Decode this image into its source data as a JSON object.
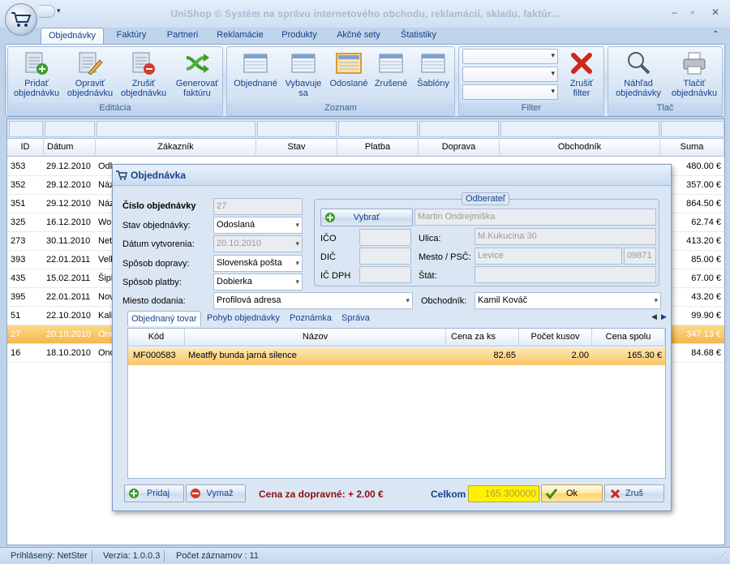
{
  "window": {
    "title": "UniShop © Systém na správu internetového obchodu, reklamácií, skladu,  faktúr..."
  },
  "ribbon_tabs": [
    "Objednávky",
    "Faktúry",
    "Partneri",
    "Reklamácie",
    "Produkty",
    "Akčné sety",
    "Štatistiky"
  ],
  "groups": {
    "editacia": {
      "label": "Editácia",
      "buttons": [
        {
          "line1": "Pridať",
          "line2": "objednávku"
        },
        {
          "line1": "Opraviť",
          "line2": "objednávku"
        },
        {
          "line1": "Zrušiť",
          "line2": "objednávku"
        },
        {
          "line1": "Generovať",
          "line2": "faktúru"
        }
      ]
    },
    "zoznam": {
      "label": "Zoznam",
      "buttons": [
        {
          "line1": "Objednané",
          "line2": ""
        },
        {
          "line1": "Vybavuje",
          "line2": "sa"
        },
        {
          "line1": "Odoslané",
          "line2": ""
        },
        {
          "line1": "Zrušené",
          "line2": ""
        },
        {
          "line1": "Šablóny",
          "line2": ""
        }
      ]
    },
    "filter": {
      "label": "Filter",
      "clear_line1": "Zrušiť",
      "clear_line2": "filter"
    },
    "tlac": {
      "label": "Tlač",
      "buttons": [
        {
          "line1": "Náhľad",
          "line2": "objednávky"
        },
        {
          "line1": "Tlačiť",
          "line2": "objednávku"
        }
      ]
    }
  },
  "grid": {
    "headers": [
      "ID",
      "Dátum",
      "Zákazník",
      "Stav",
      "Platba",
      "Doprava",
      "Obchodník",
      "Suma"
    ],
    "rows": [
      {
        "id": "353",
        "date": "29.12.2010",
        "cust": "Odb",
        "sum": "480.00 €",
        "sel": false
      },
      {
        "id": "352",
        "date": "29.12.2010",
        "cust": "Náz",
        "sum": "357.00 €",
        "sel": false
      },
      {
        "id": "351",
        "date": "29.12.2010",
        "cust": "Náz",
        "sum": "864.50 €",
        "sel": false
      },
      {
        "id": "325",
        "date": "16.12.2010",
        "cust": "Wol",
        "sum": "62.74 €",
        "sel": false
      },
      {
        "id": "273",
        "date": "30.11.2010",
        "cust": "Net",
        "sum": "413.20 €",
        "sel": false
      },
      {
        "id": "393",
        "date": "22.01.2011",
        "cust": "Velk",
        "sum": "85.00 €",
        "sel": false
      },
      {
        "id": "435",
        "date": "15.02.2011",
        "cust": "Šipl",
        "sum": "67.00 €",
        "sel": false
      },
      {
        "id": "395",
        "date": "22.01.2011",
        "cust": "Nov",
        "sum": "43.20 €",
        "sel": false
      },
      {
        "id": "51",
        "date": "22.10.2010",
        "cust": "Kali",
        "sum": "99.90 €",
        "sel": false
      },
      {
        "id": "27",
        "date": "20.10.2010",
        "cust": "Ond",
        "sum": "347.13 €",
        "sel": true
      },
      {
        "id": "16",
        "date": "18.10.2010",
        "cust": "Ond",
        "sum": "84.68 €",
        "sel": false
      }
    ]
  },
  "status": {
    "user": "Prihlásený: NetSter",
    "version": "Verzia: 1.0.0.3",
    "count": "Počet záznamov : 11"
  },
  "dialog": {
    "title": "Objednávka",
    "labels": {
      "cislo": "Číslo objednávky",
      "stav": "Stav objednávky:",
      "datum": "Dátum vytvorenia:",
      "doprava": "Spôsob dopravy:",
      "platba": "Spôsob platby:",
      "miesto": "Miesto dodania:",
      "obchodnik": "Obchodník:",
      "odberatel": "Odberateľ",
      "vybrat": "Vybrať",
      "ico": "IČO",
      "dic": "DIČ",
      "icdph": "IČ DPH",
      "ulica": "Ulica:",
      "mesto": "Mesto / PSČ:",
      "stat": "Štát:"
    },
    "values": {
      "cislo": "27",
      "stav": "Odoslaná",
      "datum": "20.10.2010",
      "doprava": "Slovenská pošta",
      "platba": "Dobierka",
      "miesto": "Profilová adresa",
      "obchodnik": "Kamil Kováč",
      "meno": "Martin Ondrejmiška",
      "ulica": "M.Kukucina 30",
      "mesto": "Levice",
      "psc": "09871"
    },
    "tabs": [
      "Objednaný tovar",
      "Pohyb objednávky",
      "Poznámka",
      "Správa"
    ],
    "items_headers": [
      "Kód",
      "Názov",
      "Cena za ks",
      "Počet kusov",
      "Cena spolu"
    ],
    "items": [
      {
        "kod": "MF000583",
        "nazov": "Meatfly bunda jarná silence",
        "cena": "82.65",
        "pocet": "2.00",
        "spolu": "165.30 €"
      }
    ],
    "footer": {
      "pridaj": "Pridaj",
      "vymaz": "Vymaž",
      "doprava_text": "Cena za dopravné: + 2.00 €",
      "celkom_label": "Celkom",
      "celkom_value": "165.300000",
      "ok": "Ok",
      "zrus": "Zruš"
    }
  }
}
